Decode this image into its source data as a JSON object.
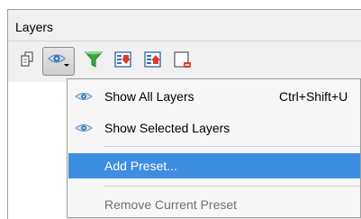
{
  "panel": {
    "title": "Layers"
  },
  "toolbar": {
    "buttons": [
      {
        "icon": "copy-icon"
      },
      {
        "icon": "eye-icon",
        "pressed": true
      },
      {
        "icon": "filter-icon"
      },
      {
        "icon": "expand-all-icon"
      },
      {
        "icon": "collapse-all-icon"
      },
      {
        "icon": "remove-layer-icon"
      }
    ]
  },
  "menu": {
    "items": [
      {
        "label": "Show All Layers",
        "shortcut": "Ctrl+Shift+U",
        "icon": "eye-icon"
      },
      {
        "label": "Show Selected Layers",
        "icon": "eye-icon"
      },
      {
        "label": "Add Preset...",
        "highlighted": true
      },
      {
        "label": "Remove Current Preset",
        "disabled": true
      }
    ]
  },
  "colors": {
    "highlight": "#3d8de0",
    "eye": "#5b8cc9",
    "filter": "#3aa845",
    "red": "#d93a2b"
  }
}
